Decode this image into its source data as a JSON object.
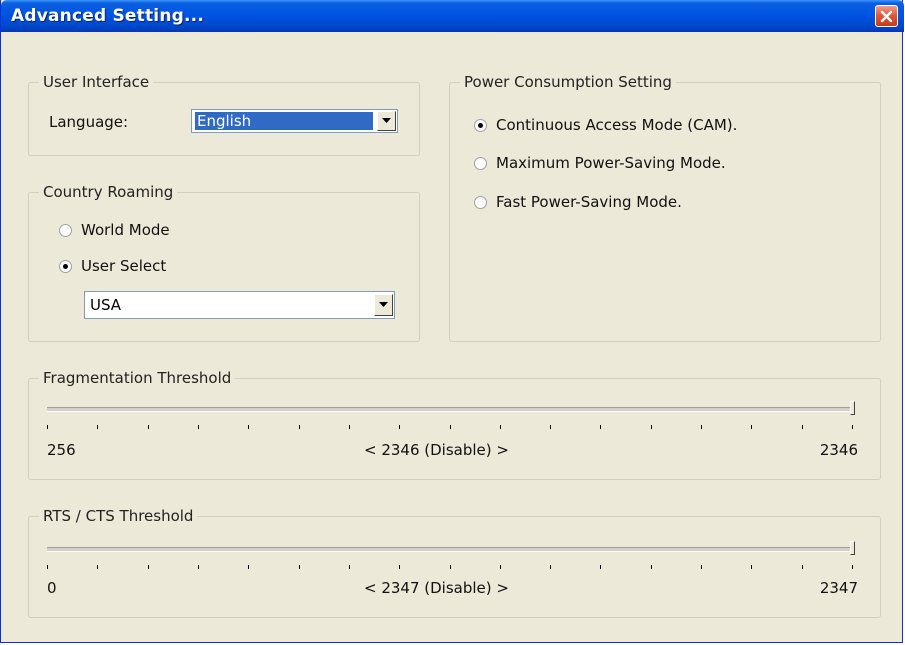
{
  "window": {
    "title": "Advanced Setting..."
  },
  "user_interface": {
    "legend": "User Interface",
    "language_label": "Language:",
    "language_value": "English"
  },
  "country_roaming": {
    "legend": "Country Roaming",
    "options": [
      {
        "label": "World Mode",
        "selected": false
      },
      {
        "label": "User Select",
        "selected": true
      }
    ],
    "country_value": "USA"
  },
  "power": {
    "legend": "Power Consumption Setting",
    "options": [
      {
        "label": "Continuous Access Mode (CAM).",
        "selected": true
      },
      {
        "label": "Maximum Power-Saving Mode.",
        "selected": false
      },
      {
        "label": "Fast Power-Saving Mode.",
        "selected": false
      }
    ]
  },
  "fragmentation": {
    "legend": "Fragmentation Threshold",
    "min_label": "256",
    "max_label": "2346",
    "current_label": "< 2346 (Disable) >",
    "value": 2346,
    "min": 256,
    "max": 2346
  },
  "rts_cts": {
    "legend": "RTS / CTS Threshold",
    "min_label": "0",
    "max_label": "2347",
    "current_label": "< 2347 (Disable) >",
    "value": 2347,
    "min": 0,
    "max": 2347
  },
  "icons": {
    "close": "close-icon",
    "dropdown": "chevron-down-icon"
  }
}
